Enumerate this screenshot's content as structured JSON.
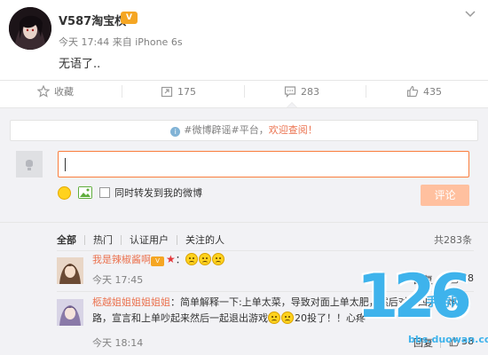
{
  "post": {
    "username": "V587淘宝权",
    "vip_badge": "V",
    "meta": "今天 17:44 来自 iPhone 6s",
    "content": "无语了.."
  },
  "actions": {
    "favorite": "收藏",
    "repost": "175",
    "comment": "283",
    "like": "435"
  },
  "notice": {
    "prefix": "#微博辟谣#平台，",
    "highlight": "欢迎查阅！"
  },
  "composer": {
    "sync_label": "同时转发到我的微博",
    "submit_label": "评论"
  },
  "filters": {
    "items": [
      "全部",
      "热门",
      "认证用户",
      "关注的人"
    ],
    "total": "共283条"
  },
  "comments": [
    {
      "name": "我是辣椒酱啊",
      "suffix": "：",
      "text": "",
      "time": "今天 17:45",
      "reply": "回复",
      "likes": "38"
    },
    {
      "name": "柩越姐姐姐姐姐姐",
      "text_line1": "：简单解释一下:上单太菜，导致对面上单太肥，然后对面四人抓炸下",
      "text_line2": "路，宣言和上单吵起来然后一起退出游戏",
      "text_line3": "20投了！！心疼",
      "time": "今天 18:14",
      "reply": "回复",
      "likes": "38"
    }
  ],
  "watermark": {
    "number": "126",
    "sub": "手游网",
    "url": "bbs.duowan.com"
  },
  "colors": {
    "accent": "#eb7350",
    "input_border": "#fa7d3c",
    "submit_disabled": "#ffc09f",
    "panel_bg": "#f2f2f5",
    "watermark": "#3eb3ec"
  }
}
